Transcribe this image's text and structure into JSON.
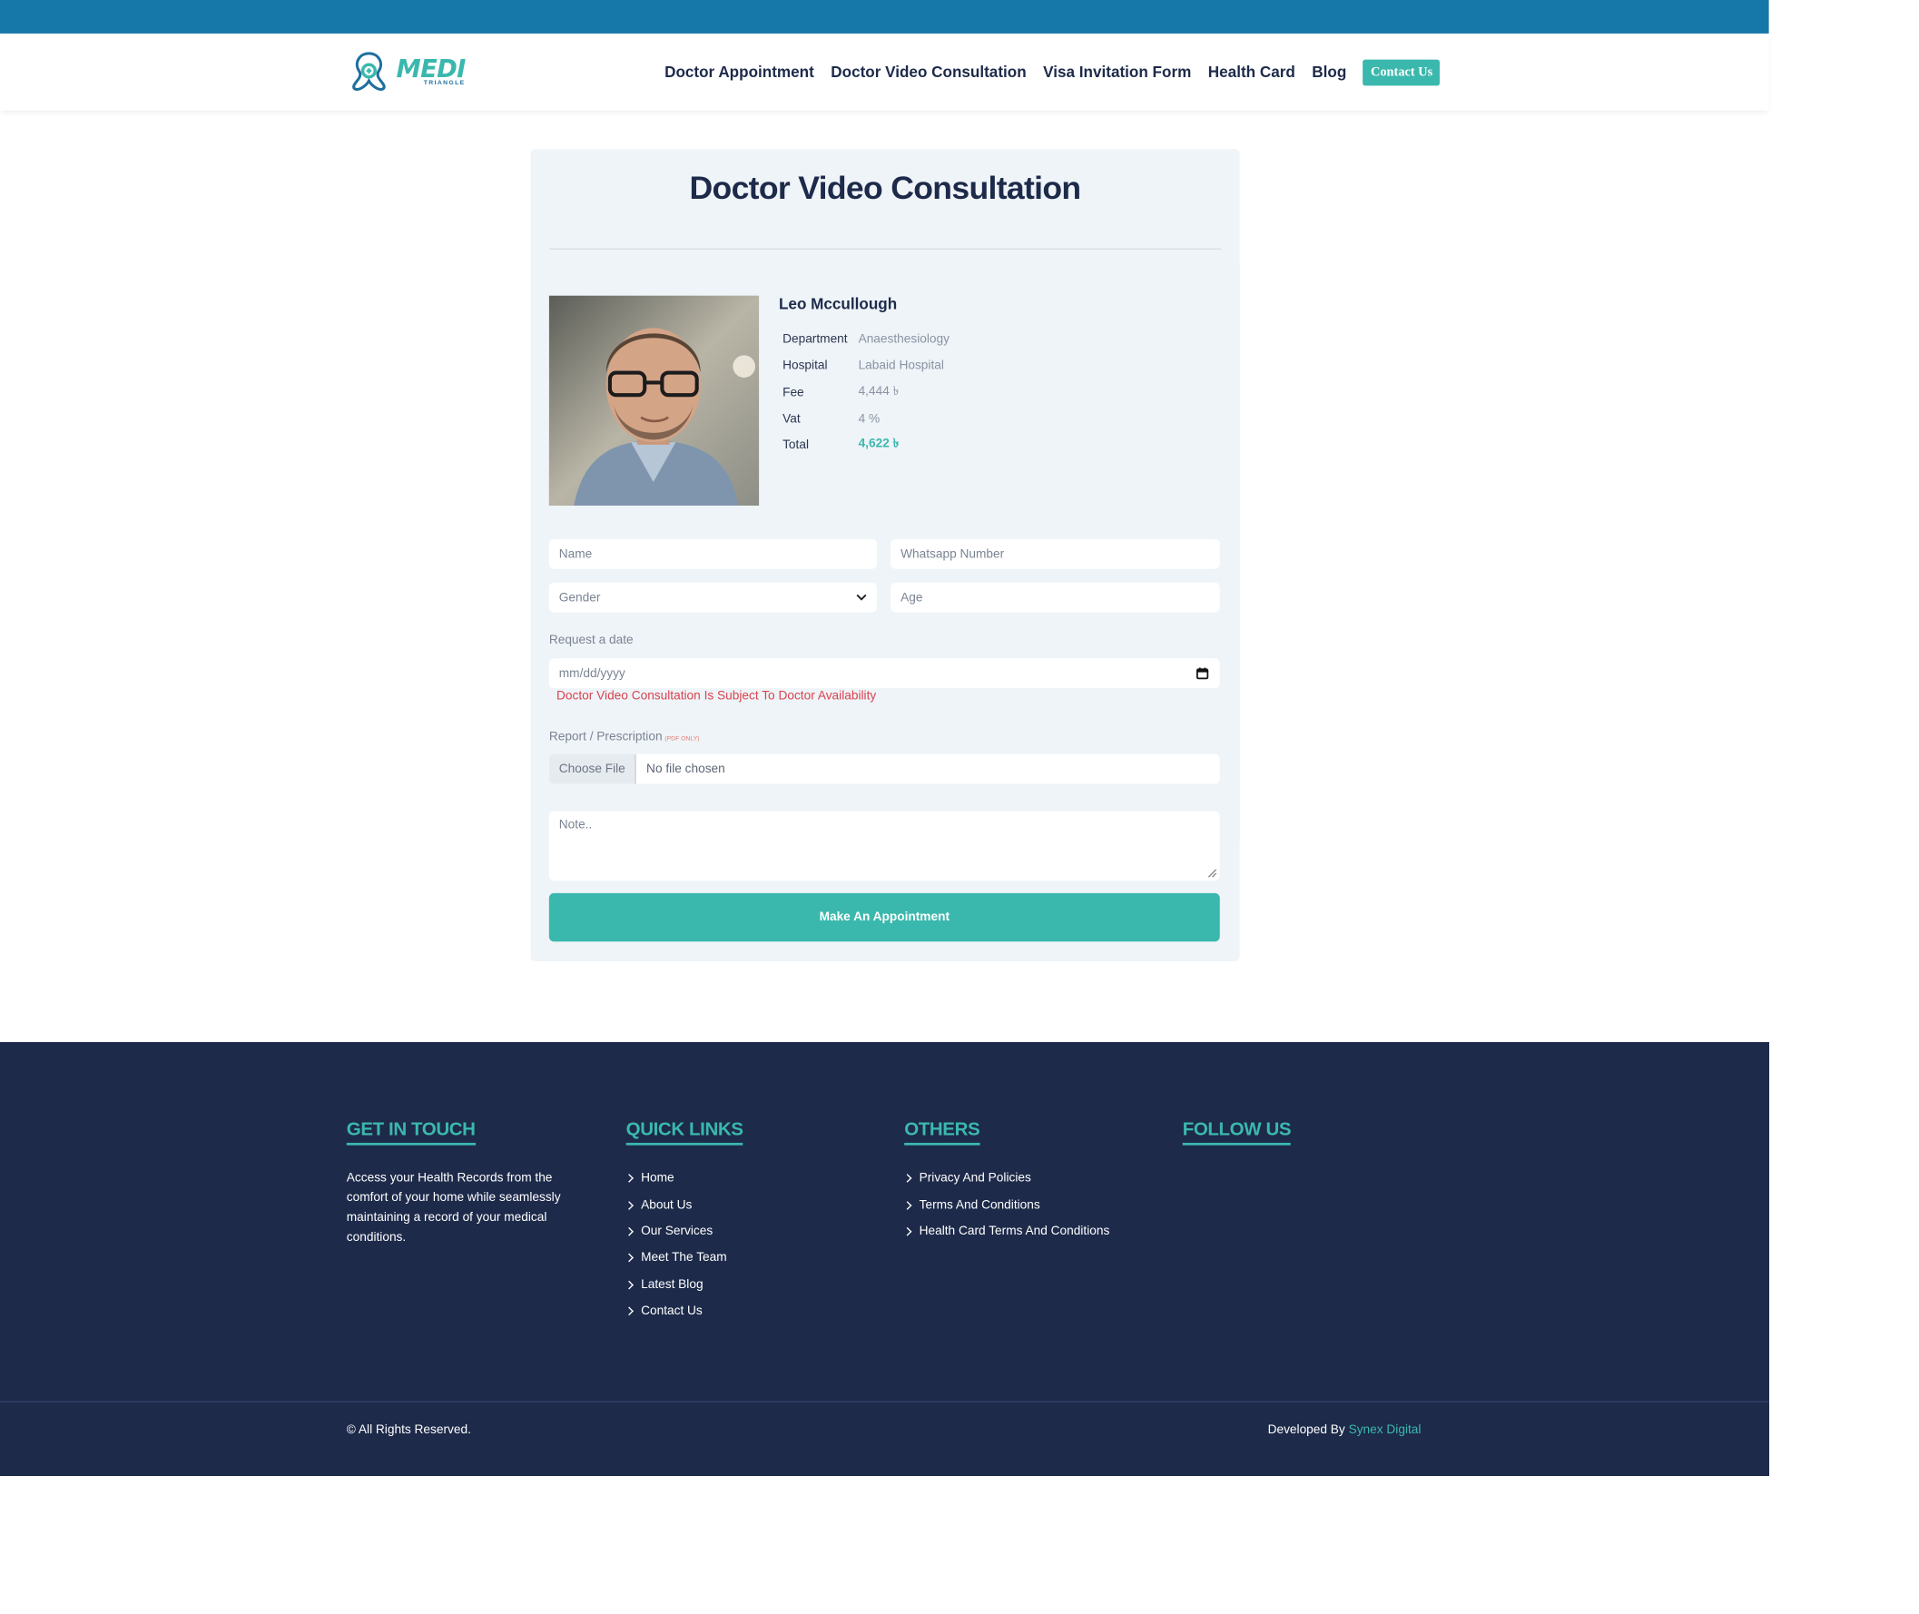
{
  "nav": {
    "items": [
      "Doctor Appointment",
      "Doctor Video Consultation",
      "Visa Invitation Form",
      "Health Card",
      "Blog"
    ],
    "contact_label": "Contact Us"
  },
  "logo": {
    "title": "MEDI",
    "subtitle": "TRIANGLE"
  },
  "card": {
    "title": "Doctor Video Consultation",
    "doctor": {
      "name": "Leo Mccullough",
      "rows": [
        {
          "key": "Department",
          "value": "Anaesthesiology"
        },
        {
          "key": "Hospital",
          "value": "Labaid Hospital"
        },
        {
          "key": "Fee",
          "value": "4,444 ৳"
        },
        {
          "key": "Vat",
          "value": "4 %"
        },
        {
          "key": "Total",
          "value": "4,622 ৳"
        }
      ]
    },
    "form": {
      "name_placeholder": "Name",
      "whatsapp_placeholder": "Whatsapp Number",
      "gender_placeholder": "Gender",
      "age_placeholder": "Age",
      "date_label": "Request a date",
      "date_placeholder": "mm/dd/yyyy",
      "date_warning": "Doctor Video Consultation Is Subject To Doctor Availability",
      "report_label": "Report / Prescription",
      "pdf_only": "(PDF ONLY)",
      "file_button": "Choose File",
      "file_status": "No file chosen",
      "note_placeholder": "Note..",
      "submit_label": "Make An Appointment"
    }
  },
  "footer": {
    "get_in_touch": {
      "title": "GET IN TOUCH",
      "text": "Access your Health Records from the comfort of your home while seamlessly maintaining a record of your medical conditions."
    },
    "quick_links": {
      "title": "QUICK LINKS",
      "items": [
        "Home",
        "About Us",
        "Our Services",
        "Meet The Team",
        "Latest Blog",
        "Contact Us"
      ]
    },
    "others": {
      "title": "OTHERS",
      "items": [
        "Privacy And Policies",
        "Terms And Conditions",
        "Health Card Terms And Conditions"
      ]
    },
    "follow_us": {
      "title": "FOLLOW US"
    },
    "copyright": "© All Rights Reserved.",
    "developed_by": "Developed By",
    "developer": "Synex Digital"
  },
  "colors": {
    "brand_blue": "#1677a9",
    "accent_teal": "#3bb8ad",
    "footer_navy": "#1d2a4a",
    "warning_red": "#d9434f"
  }
}
